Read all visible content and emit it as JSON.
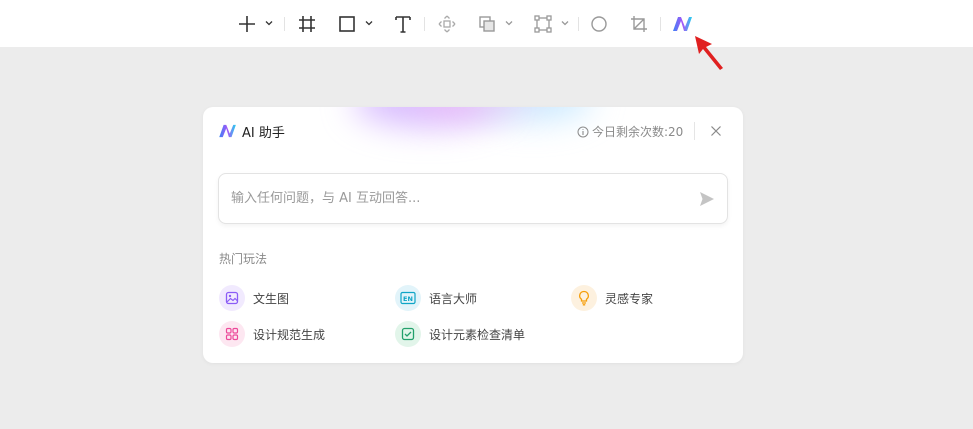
{
  "toolbar": {
    "tools": [
      {
        "name": "add-icon",
        "has_dropdown": true
      },
      {
        "name": "frame-icon",
        "has_dropdown": false
      },
      {
        "name": "rectangle-icon",
        "has_dropdown": true
      },
      {
        "name": "text-icon",
        "has_dropdown": false
      },
      {
        "name": "move-icon",
        "has_dropdown": false
      },
      {
        "name": "boolean-icon",
        "has_dropdown": true
      },
      {
        "name": "component-icon",
        "has_dropdown": true
      },
      {
        "name": "circle-icon",
        "has_dropdown": false
      },
      {
        "name": "crop-icon",
        "has_dropdown": false
      },
      {
        "name": "ai-logo-icon",
        "has_dropdown": false
      }
    ]
  },
  "panel": {
    "title": "AI 助手",
    "quota_label": "今日剩余次数:20",
    "input": {
      "placeholder": "输入任何问题，与 AI 互动回答...",
      "value": ""
    },
    "section_title": "热门玩法",
    "features": [
      {
        "label": "文生图",
        "icon": "image-icon",
        "color": "#8b5cf6",
        "bg": "#f1eafe"
      },
      {
        "label": "语言大师",
        "icon": "en-icon",
        "color": "#0ea5c6",
        "bg": "#e2f4fa"
      },
      {
        "label": "灵感专家",
        "icon": "lightbulb-icon",
        "color": "#f59e0b",
        "bg": "#fdf1df"
      },
      {
        "label": "设计规范生成",
        "icon": "grid-icon",
        "color": "#ec4899",
        "bg": "#fde7f1"
      },
      {
        "label": "设计元素检查清单",
        "icon": "checklist-icon",
        "color": "#22a06b",
        "bg": "#e2f5ea"
      }
    ]
  },
  "colors": {
    "accent_red": "#e02020",
    "logo_blue": "#3b82f6",
    "logo_pink": "#ec4899",
    "logo_cyan": "#22d3ee"
  }
}
